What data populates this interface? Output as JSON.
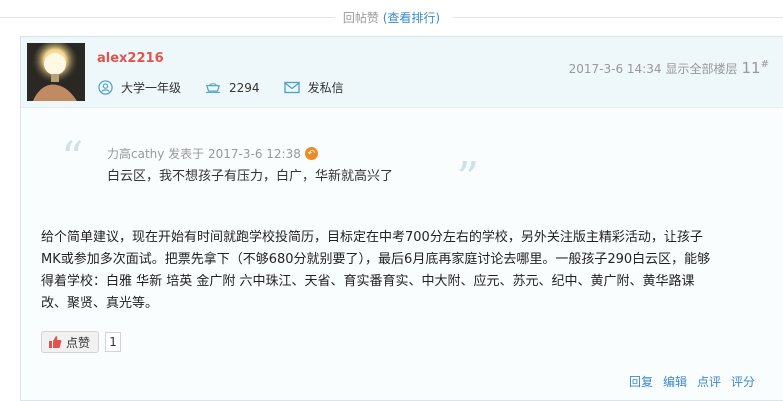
{
  "top_bar": {
    "title": "回帖赞",
    "link": "(查看排行)"
  },
  "post": {
    "username": "alex2216",
    "grade": "大学一年级",
    "points": "2294",
    "private_message": "发私信",
    "timestamp": "2017-3-6 14:34",
    "show_all_floors": "显示全部楼层",
    "floor_number": "11",
    "floor_suffix": "#",
    "quote": {
      "author_line": "力高cathy 发表于 2017-3-6 12:38",
      "text": "白云区，我不想孩子有压力，白广，华新就高兴了"
    },
    "body_lines": [
      "给个简单建议，现在开始有时间就跑学校投简历，目标定在中考700分左右的学校，另外关注版主精彩活动，让孩子",
      "MK或参加多次面试。把票先拿下（不够680分就别要了），最后6月底再家庭讨论去哪里。一般孩子290白云区，能够",
      "得着学校：白雅 华新 培英 金广附 六中珠江、天省、育实番育实、中大附、应元、苏元、纪中、黄广附、黄华路课",
      "改、聚贤、真光等。"
    ],
    "like_label": "点赞",
    "like_count": "1",
    "actions": [
      "回复",
      "编辑",
      "点评",
      "评分"
    ]
  },
  "colors": {
    "username": "#e0544f",
    "link": "#3b8ac8",
    "header_bg": "#eef7f9",
    "quote_mark": "#cfe0ea"
  },
  "icons": {
    "grade": "user-circle-icon",
    "points": "coin-stack-icon",
    "message": "envelope-icon",
    "quote_source": "return-arrow-icon",
    "like": "thumbs-up-icon"
  }
}
